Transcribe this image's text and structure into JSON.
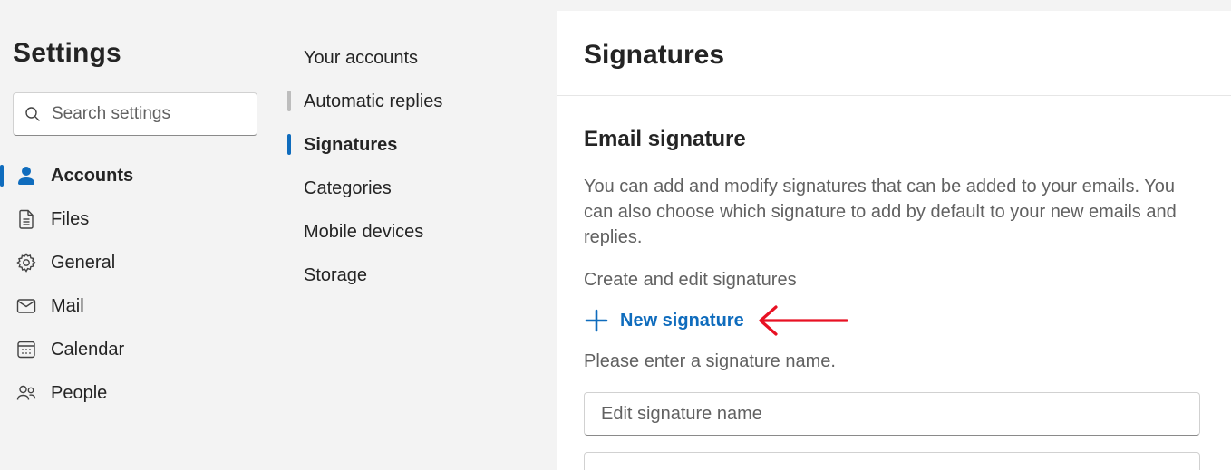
{
  "left_nav": {
    "title": "Settings",
    "search": {
      "placeholder": "Search settings",
      "value": ""
    },
    "items": [
      {
        "label": "Accounts",
        "icon": "person-icon",
        "active": true
      },
      {
        "label": "Files",
        "icon": "document-icon"
      },
      {
        "label": "General",
        "icon": "gear-icon"
      },
      {
        "label": "Mail",
        "icon": "mail-icon"
      },
      {
        "label": "Calendar",
        "icon": "calendar-icon"
      },
      {
        "label": "People",
        "icon": "people-icon"
      }
    ]
  },
  "sub_nav": {
    "items": [
      {
        "label": "Your accounts"
      },
      {
        "label": "Automatic replies",
        "hover": true
      },
      {
        "label": "Signatures",
        "active": true
      },
      {
        "label": "Categories"
      },
      {
        "label": "Mobile devices"
      },
      {
        "label": "Storage"
      }
    ]
  },
  "main": {
    "title": "Signatures",
    "section_title": "Email signature",
    "description": "You can add and modify signatures that can be added to your emails. You can also choose which signature to add by default to your new emails and replies.",
    "create_label": "Create and edit signatures",
    "new_signature_label": "New signature",
    "enter_name_label": "Please enter a signature name.",
    "signature_name": {
      "placeholder": "Edit signature name",
      "value": ""
    }
  },
  "colors": {
    "accent": "#0f6cbd",
    "annotation_arrow": "#e81123",
    "background": "#f3f3f3",
    "panel": "#ffffff"
  }
}
